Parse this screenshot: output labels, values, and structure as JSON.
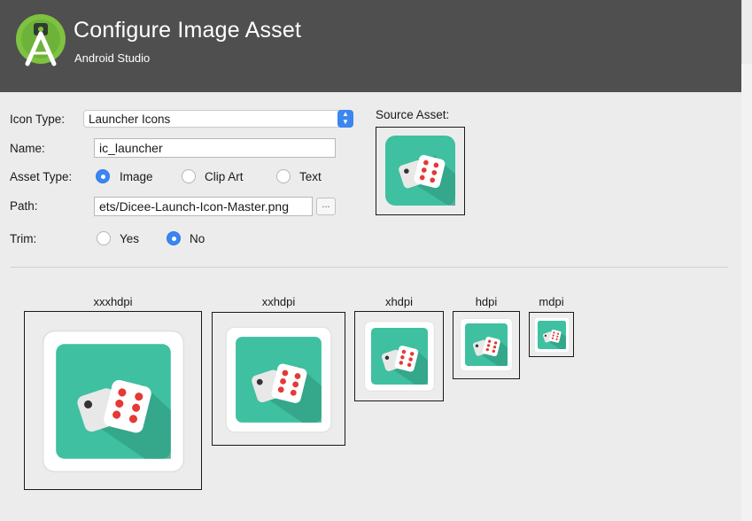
{
  "header": {
    "title": "Configure Image Asset",
    "subtitle": "Android Studio"
  },
  "form": {
    "icon_type_label": "Icon Type:",
    "icon_type_value": "Launcher Icons",
    "name_label": "Name:",
    "name_value": "ic_launcher",
    "asset_type_label": "Asset Type:",
    "asset_type_options": [
      "Image",
      "Clip Art",
      "Text"
    ],
    "asset_type_selected": "Image",
    "path_label": "Path:",
    "path_value": "ets/Dicee-Launch-Icon-Master.png",
    "browse_label": "...",
    "trim_label": "Trim:",
    "trim_options": [
      "Yes",
      "No"
    ],
    "trim_selected": "No"
  },
  "source_asset": {
    "label": "Source Asset:"
  },
  "previews": {
    "densities": [
      "xxxhdpi",
      "xxhdpi",
      "xhdpi",
      "hdpi",
      "mdpi"
    ]
  },
  "colors": {
    "header_bg": "#4f4f4f",
    "accent": "#3b86f0",
    "icon_teal": "#3fc0a0",
    "dice_pip": "#e53935"
  },
  "icons": [
    "android-studio-logo",
    "dice-launcher-icon",
    "chevron-up-down-icon"
  ]
}
